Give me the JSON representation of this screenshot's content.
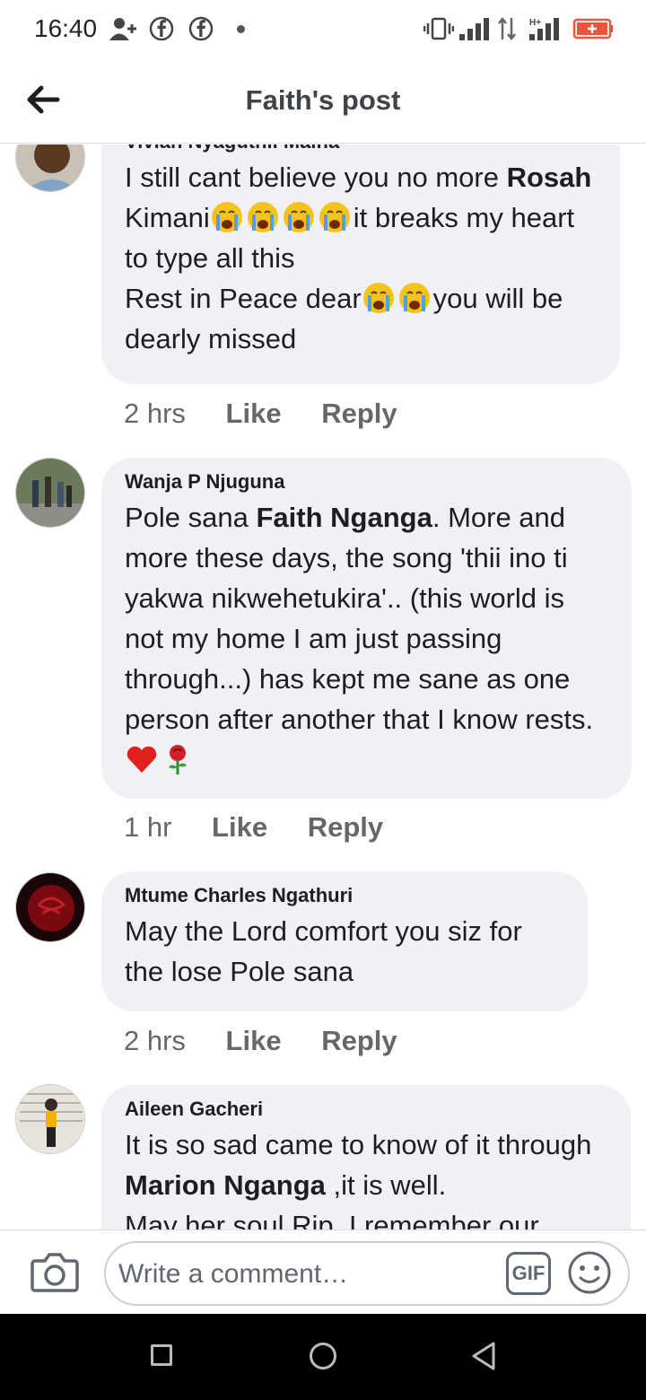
{
  "status": {
    "time": "16:40",
    "icons": [
      "add-person-icon",
      "facebook-icon",
      "facebook-icon",
      "dot-icon",
      "vibrate-icon",
      "signal-icon",
      "data-arrows-icon",
      "hplus-signal-icon",
      "battery-icon"
    ]
  },
  "header": {
    "title": "Faith's post"
  },
  "comments": [
    {
      "author": "Vivian Nyaguthii Maina",
      "time": "2 hrs",
      "like": "Like",
      "reply": "Reply",
      "parts": [
        "I still cant believe you no more ",
        "Rosah",
        " Kimani",
        "it breaks my heart to type all this",
        "Rest in Peace dear",
        "you will be dearly missed"
      ]
    },
    {
      "author": "Wanja P Njuguna",
      "time": "1 hr",
      "like": "Like",
      "reply": "Reply",
      "parts": [
        "Pole sana ",
        "Faith Nganga",
        ". More and more these days, the song 'thii ino ti yakwa nikwehetukira'.. (this world is not my home I am just passing through...) has kept me sane as one person after another that I know rests."
      ]
    },
    {
      "author": "Mtume Charles Ngathuri",
      "time": "2 hrs",
      "like": "Like",
      "reply": "Reply",
      "text": "May the Lord comfort you siz for the lose Pole sana"
    },
    {
      "author": "Aileen Gacheri",
      "parts": [
        "It is so sad came to know of it through ",
        "Marion Nganga",
        " ,it is well.",
        "May her soul Rip. I remember our"
      ]
    }
  ],
  "composer": {
    "placeholder": "Write a comment…",
    "gif_label": "GIF"
  }
}
